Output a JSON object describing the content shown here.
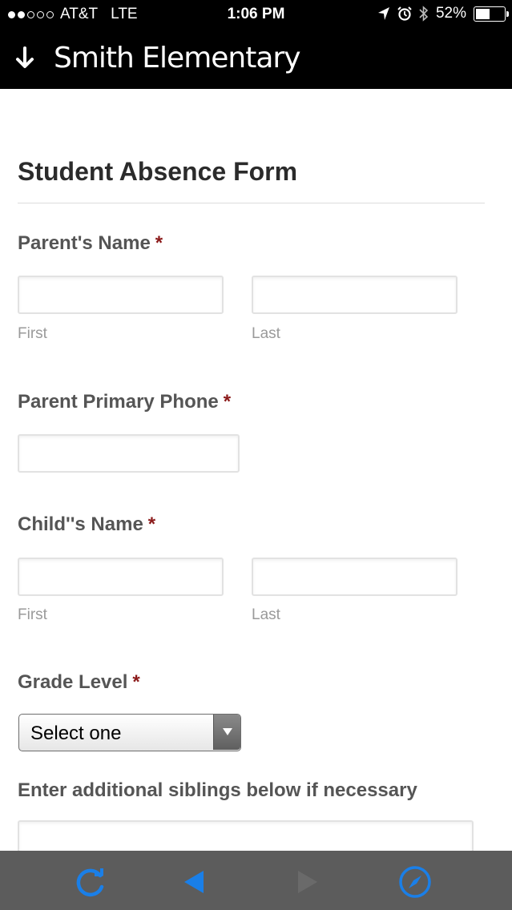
{
  "status_bar": {
    "carrier": "AT&T",
    "network": "LTE",
    "time": "1:06 PM",
    "battery": "52%",
    "battery_level": 0.52,
    "icons": [
      "location-arrow-icon",
      "alarm-icon",
      "bluetooth-icon",
      "battery-icon"
    ]
  },
  "header": {
    "title": "Smith Elementary",
    "icon": "download-arrow-icon"
  },
  "form": {
    "title": "Student Absence Form",
    "required_mark": "*",
    "parent_name": {
      "label": "Parent's Name",
      "first_label": "First",
      "last_label": "Last"
    },
    "parent_phone": {
      "label": "Parent Primary Phone"
    },
    "child_name": {
      "label": "Child''s Name",
      "first_label": "First",
      "last_label": "Last"
    },
    "grade_level": {
      "label": "Grade Level",
      "selected": "Select one"
    },
    "siblings": {
      "label": "Enter additional siblings below if necessary"
    }
  },
  "toolbar": {
    "icons": [
      "reload-icon",
      "back-icon",
      "forward-icon",
      "compass-icon"
    ],
    "accent_color": "#1a7fe8"
  }
}
